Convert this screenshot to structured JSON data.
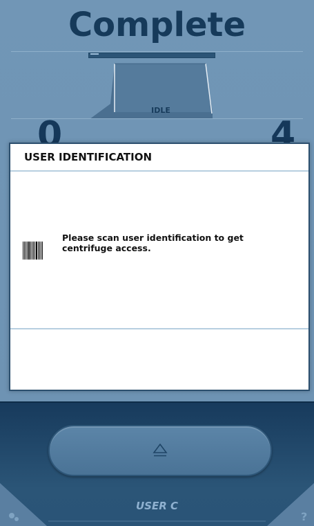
{
  "status": {
    "title": "Complete",
    "rotor_state": "IDLE",
    "left_value": "0",
    "right_value": "4"
  },
  "modal": {
    "title": "USER IDENTIFICATION",
    "message": "Please scan user identification to get centrifuge access.",
    "icon": "barcode-icon"
  },
  "footer": {
    "eject_icon": "eject-icon",
    "user_label": "USER C",
    "settings_icon": "gear-icon",
    "help_icon": "help-icon",
    "help_glyph": "?"
  },
  "colors": {
    "background": "#6e93b3",
    "title": "#163a5a",
    "footer_dark": "#173a5c",
    "modal_border": "#2c4f6e"
  }
}
